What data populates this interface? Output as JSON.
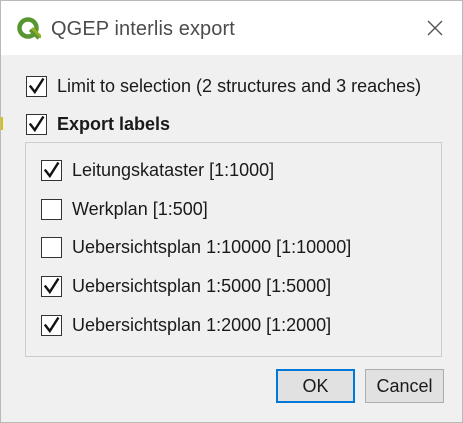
{
  "window": {
    "title": "QGEP interlis export",
    "icon": "qgis-logo-icon",
    "close_icon": "close-icon"
  },
  "options": {
    "limit_to_selection": {
      "label": "Limit to selection (2 structures and 3 reaches)",
      "checked": true
    },
    "export_labels": {
      "label": "Export labels",
      "checked": true
    }
  },
  "label_scales": [
    {
      "label": "Leitungskataster [1:1000]",
      "checked": true
    },
    {
      "label": "Werkplan [1:500]",
      "checked": false
    },
    {
      "label": "Uebersichtsplan 1:10000 [1:10000]",
      "checked": false
    },
    {
      "label": "Uebersichtsplan 1:5000 [1:5000]",
      "checked": true
    },
    {
      "label": "Uebersichtsplan 1:2000 [1:2000]",
      "checked": true
    }
  ],
  "buttons": {
    "ok": "OK",
    "cancel": "Cancel"
  },
  "colors": {
    "qgis_green": "#589632",
    "qgis_yellow": "#ee7913",
    "focus_blue": "#0078d7"
  }
}
